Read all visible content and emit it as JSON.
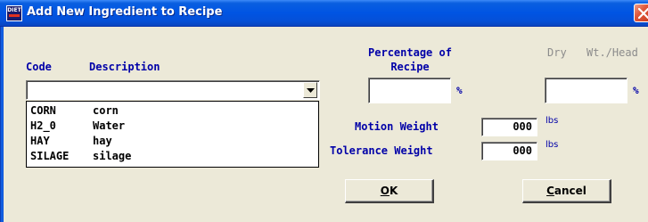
{
  "window": {
    "title": "Add New Ingredient to Recipe",
    "icon_text": "DIET"
  },
  "columns": {
    "code": "Code",
    "description": "Description",
    "percentage_line1": "Percentage of",
    "percentage_line2": "Recipe",
    "dry": "Dry",
    "wt_head": "Wt./Head"
  },
  "ingredient_select": {
    "value": ""
  },
  "ingredients": [
    {
      "code": "CORN",
      "description": "corn"
    },
    {
      "code": "H2_0",
      "description": "Water"
    },
    {
      "code": "HAY",
      "description": "hay"
    },
    {
      "code": "SILAGE",
      "description": "silage"
    }
  ],
  "percentage_field": {
    "value": "",
    "unit": "%"
  },
  "dry_field": {
    "value": "",
    "unit": "%"
  },
  "motion_weight": {
    "label": "Motion Weight",
    "value": "000",
    "unit": "lbs"
  },
  "tolerance_weight": {
    "label": "Tolerance Weight",
    "value": "000",
    "unit": "lbs"
  },
  "buttons": {
    "ok_mnemonic": "O",
    "ok_rest": "K",
    "cancel_mnemonic": "C",
    "cancel_rest": "ancel"
  }
}
